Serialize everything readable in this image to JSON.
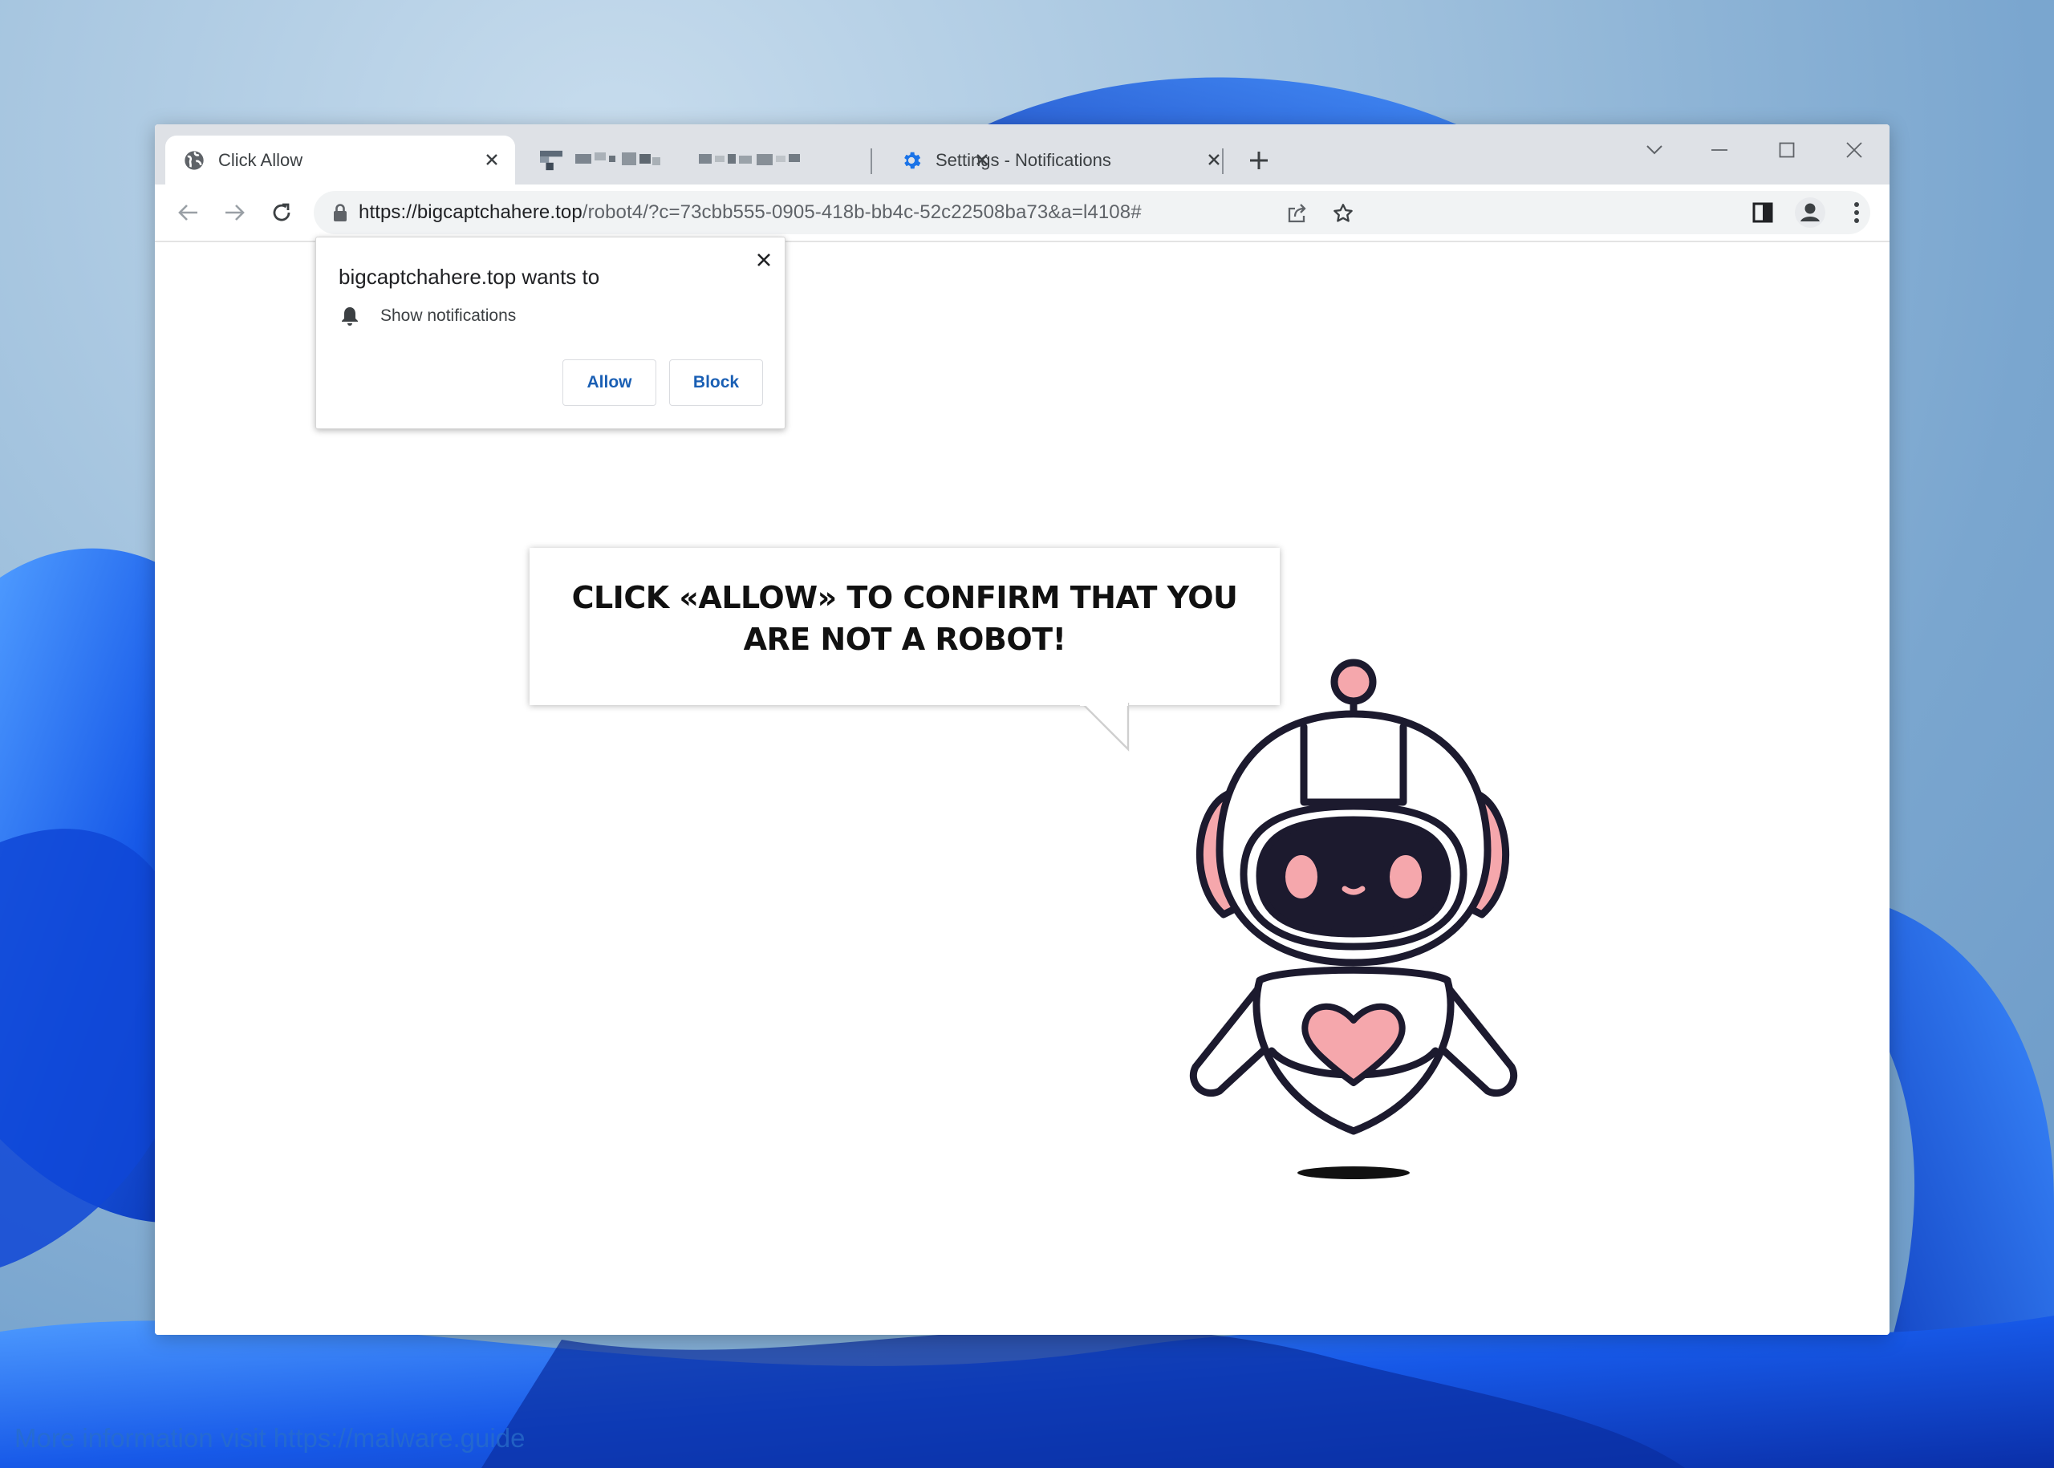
{
  "browser": {
    "tabs": [
      {
        "title": "Click Allow",
        "active": true,
        "icon": "globe-icon"
      },
      {
        "title": "",
        "active": false,
        "icon": "pixelated-favicon-icon"
      },
      {
        "title": "Settings - Notifications",
        "active": false,
        "icon": "gear-icon"
      }
    ],
    "new_tab_label": "+",
    "url_host": "https://bigcaptchahere.top",
    "url_path": "/robot4/?c=73cbb555-0905-418b-bb4c-52c22508ba73&a=l4108#"
  },
  "permission_prompt": {
    "heading": "bigcaptchahere.top wants to",
    "permission": "Show notifications",
    "allow_label": "Allow",
    "block_label": "Block"
  },
  "page": {
    "message_line1": "CLICK «ALLOW» TO CONFIRM THAT YOU",
    "message_line2": "ARE NOT A ROBOT!"
  },
  "watermark": "More information visit https://malware.guide",
  "colors": {
    "accent_blue": "#1a73e8",
    "robot_pink": "#f5a7ac",
    "robot_outline": "#1c1a2e",
    "wallpaper_blue": "#1a5fe0"
  }
}
